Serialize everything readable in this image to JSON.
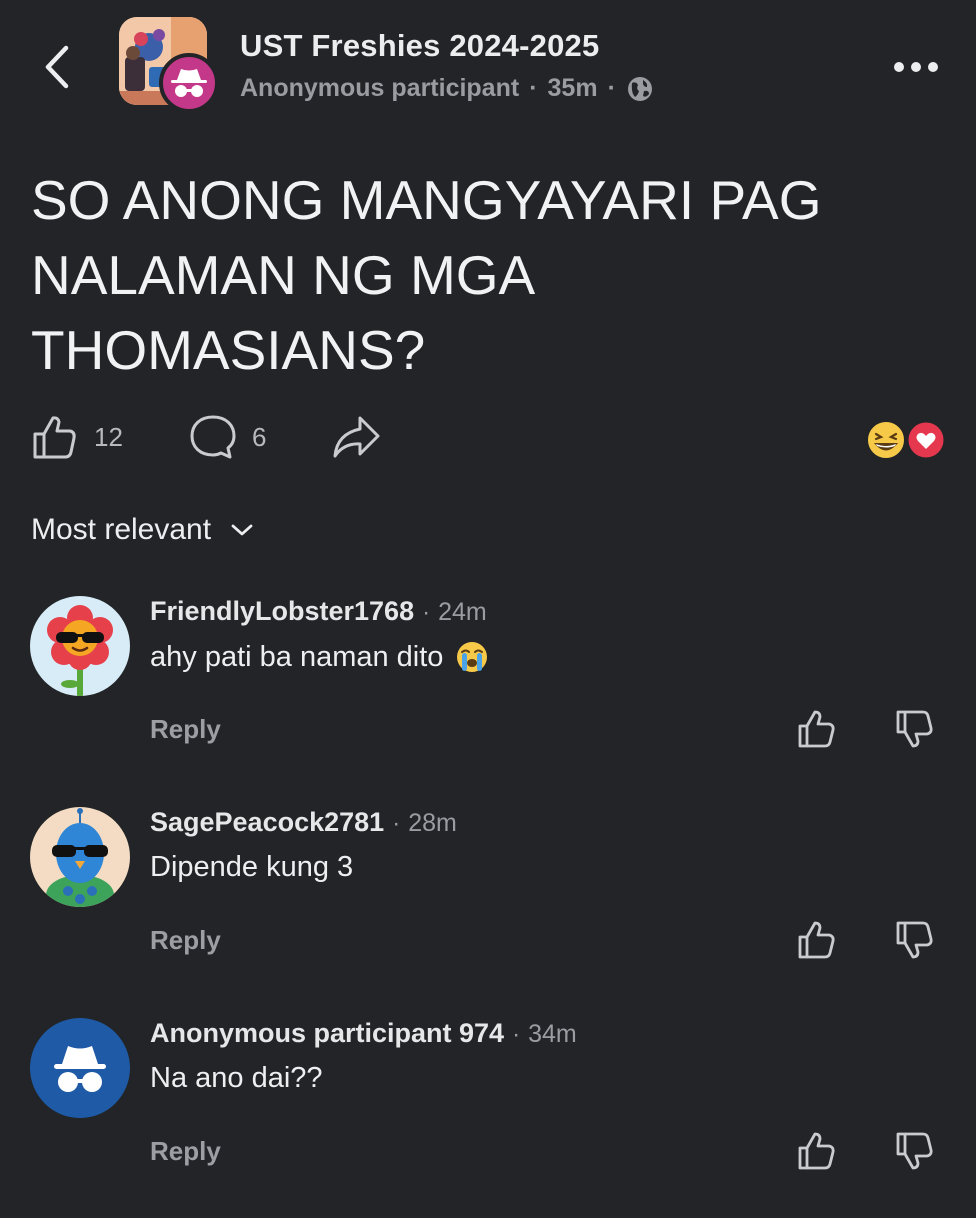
{
  "header": {
    "group_name": "UST Freshies 2024-2025",
    "author": "Anonymous participant",
    "time": "35m",
    "separator": "·",
    "visibility_icon": "globe-icon",
    "back_icon": "chevron-left-icon",
    "more_icon": "more-horizontal-icon"
  },
  "post": {
    "title": "SO ANONG MANGYAYARI PAG NALAMAN NG MGA THOMASIANS?"
  },
  "actions": {
    "like_count": "12",
    "comment_count": "6",
    "reactions": [
      "grinning-squinting-face-emoji",
      "heart-reaction"
    ]
  },
  "sort": {
    "label": "Most relevant"
  },
  "comments": [
    {
      "author": "FriendlyLobster1768",
      "time": "24m",
      "text": "ahy pati ba naman dito",
      "emoji": "loudly-crying-face-emoji",
      "avatar": "flower-sunglasses-avatar",
      "reply_label": "Reply"
    },
    {
      "author": "SagePeacock2781",
      "time": "28m",
      "text": "Dipende kung 3",
      "avatar": "peacock-sunglasses-avatar",
      "reply_label": "Reply"
    },
    {
      "author": "Anonymous participant 974",
      "time": "34m",
      "text": "Na ano dai??",
      "avatar": "anonymous-avatar",
      "reply_label": "Reply"
    }
  ],
  "colors": {
    "background": "#232427",
    "text_primary": "#eceef0",
    "text_secondary": "#9a9ca1",
    "anon_badge": "#c4388a",
    "anon_avatar": "#1f5aa6",
    "heart": "#e5384f",
    "emoji_yellow": "#f7c948"
  }
}
